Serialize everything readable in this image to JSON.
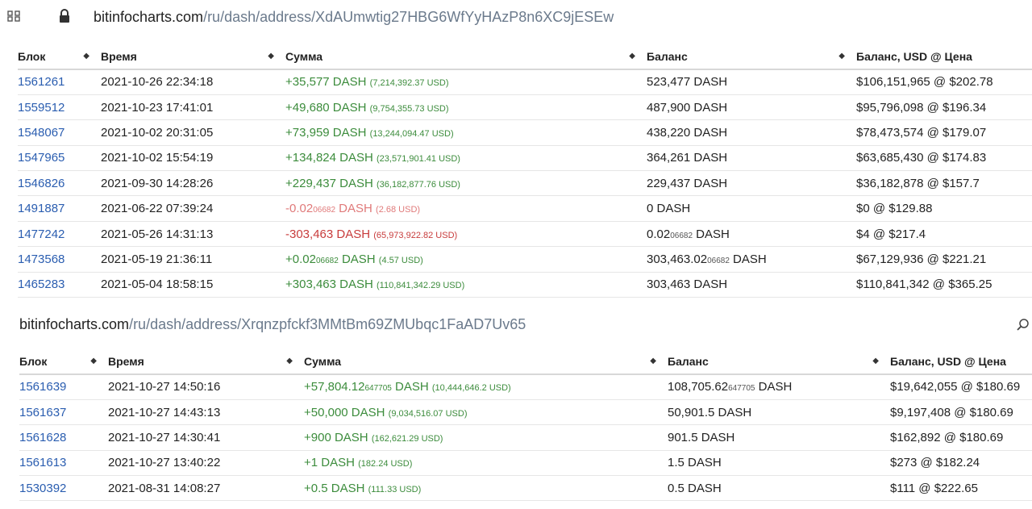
{
  "top_url": {
    "host": "bitinfocharts.com",
    "path": "/ru/dash/address/XdAUmwtig27HBG6WfYyHAzP8n6XC9jESEw"
  },
  "second_url": {
    "host": "bitinfocharts.com",
    "path": "/ru/dash/address/Xrqnzpfckf3MMtBm69ZMUbqc1FaAD7Uv65"
  },
  "headers": {
    "block": "Блок",
    "time": "Время",
    "amount": "Сумма",
    "balance": "Баланс",
    "balance_usd": "Баланс, USD @ Цена"
  },
  "table1": [
    {
      "block": "1561261",
      "time": "2021-10-26 22:34:18",
      "amount": "+35,577",
      "amount_small": "",
      "unit": " DASH",
      "usd": "(7,214,392.37 USD)",
      "type": "pos",
      "balance": "523,477",
      "balance_small": "",
      "balance_unit": " DASH",
      "balance_usd": "$106,151,965 @ $202.78"
    },
    {
      "block": "1559512",
      "time": "2021-10-23 17:41:01",
      "amount": "+49,680",
      "amount_small": "",
      "unit": " DASH",
      "usd": "(9,754,355.73 USD)",
      "type": "pos",
      "balance": "487,900",
      "balance_small": "",
      "balance_unit": " DASH",
      "balance_usd": "$95,796,098 @ $196.34"
    },
    {
      "block": "1548067",
      "time": "2021-10-02 20:31:05",
      "amount": "+73,959",
      "amount_small": "",
      "unit": " DASH",
      "usd": "(13,244,094.47 USD)",
      "type": "pos",
      "balance": "438,220",
      "balance_small": "",
      "balance_unit": " DASH",
      "balance_usd": "$78,473,574 @ $179.07"
    },
    {
      "block": "1547965",
      "time": "2021-10-02 15:54:19",
      "amount": "+134,824",
      "amount_small": "",
      "unit": " DASH",
      "usd": "(23,571,901.41 USD)",
      "type": "pos",
      "balance": "364,261",
      "balance_small": "",
      "balance_unit": " DASH",
      "balance_usd": "$63,685,430 @ $174.83"
    },
    {
      "block": "1546826",
      "time": "2021-09-30 14:28:26",
      "amount": "+229,437",
      "amount_small": "",
      "unit": " DASH",
      "usd": "(36,182,877.76 USD)",
      "type": "pos",
      "balance": "229,437",
      "balance_small": "",
      "balance_unit": " DASH",
      "balance_usd": "$36,182,878 @ $157.7"
    },
    {
      "block": "1491887",
      "time": "2021-06-22 07:39:24",
      "amount": "-0.02",
      "amount_small": "06682",
      "unit": " DASH",
      "usd": "(2.68 USD)",
      "type": "negl",
      "balance": "0",
      "balance_small": "",
      "balance_unit": " DASH",
      "balance_usd": "$0 @ $129.88"
    },
    {
      "block": "1477242",
      "time": "2021-05-26 14:31:13",
      "amount": "-303,463",
      "amount_small": "",
      "unit": " DASH",
      "usd": "(65,973,922.82 USD)",
      "type": "neg",
      "balance": "0.02",
      "balance_small": "06682",
      "balance_unit": " DASH",
      "balance_usd": "$4 @ $217.4"
    },
    {
      "block": "1473568",
      "time": "2021-05-19 21:36:11",
      "amount": "+0.02",
      "amount_small": "06682",
      "unit": " DASH",
      "usd": "(4.57 USD)",
      "type": "pos",
      "balance": "303,463.02",
      "balance_small": "06682",
      "balance_unit": " DASH",
      "balance_usd": "$67,129,936 @ $221.21"
    },
    {
      "block": "1465283",
      "time": "2021-05-04 18:58:15",
      "amount": "+303,463",
      "amount_small": "",
      "unit": " DASH",
      "usd": "(110,841,342.29 USD)",
      "type": "pos",
      "balance": "303,463",
      "balance_small": "",
      "balance_unit": " DASH",
      "balance_usd": "$110,841,342 @ $365.25"
    }
  ],
  "table2": [
    {
      "block": "1561639",
      "time": "2021-10-27 14:50:16",
      "amount": "+57,804.12",
      "amount_small": "647705",
      "unit": " DASH",
      "usd": "(10,444,646.2 USD)",
      "type": "pos",
      "balance": "108,705.62",
      "balance_small": "647705",
      "balance_unit": " DASH",
      "balance_usd": "$19,642,055 @ $180.69"
    },
    {
      "block": "1561637",
      "time": "2021-10-27 14:43:13",
      "amount": "+50,000",
      "amount_small": "",
      "unit": " DASH",
      "usd": "(9,034,516.07 USD)",
      "type": "pos",
      "balance": "50,901.5",
      "balance_small": "",
      "balance_unit": " DASH",
      "balance_usd": "$9,197,408 @ $180.69"
    },
    {
      "block": "1561628",
      "time": "2021-10-27 14:30:41",
      "amount": "+900",
      "amount_small": "",
      "unit": " DASH",
      "usd": "(162,621.29 USD)",
      "type": "pos",
      "balance": "901.5",
      "balance_small": "",
      "balance_unit": " DASH",
      "balance_usd": "$162,892 @ $180.69"
    },
    {
      "block": "1561613",
      "time": "2021-10-27 13:40:22",
      "amount": "+1",
      "amount_small": "",
      "unit": " DASH",
      "usd": "(182.24 USD)",
      "type": "pos",
      "balance": "1.5",
      "balance_small": "",
      "balance_unit": " DASH",
      "balance_usd": "$273 @ $182.24"
    },
    {
      "block": "1530392",
      "time": "2021-08-31 14:08:27",
      "amount": "+0.5",
      "amount_small": "",
      "unit": " DASH",
      "usd": "(111.33 USD)",
      "type": "pos",
      "balance": "0.5",
      "balance_small": "",
      "balance_unit": " DASH",
      "balance_usd": "$111 @ $222.65"
    }
  ],
  "colors": {
    "block_link": "#2a5db0",
    "positive": "#3c8c3c",
    "negative": "#c83c3c",
    "negative_light": "#e07a7a"
  },
  "icons": [
    "apps-grid-icon",
    "lock-icon",
    "search-icon"
  ]
}
